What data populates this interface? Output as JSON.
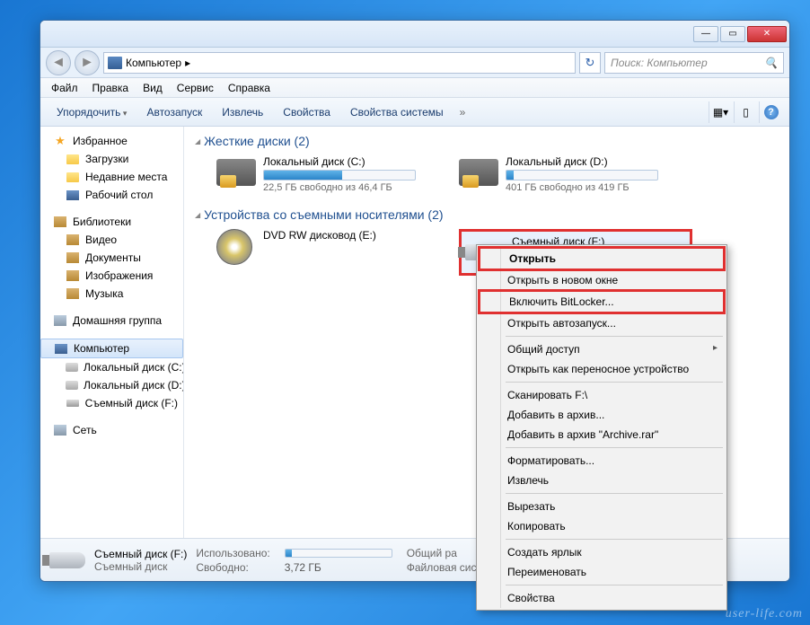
{
  "breadcrumb": {
    "root": "Компьютер",
    "sep": "▸"
  },
  "search": {
    "placeholder": "Поиск: Компьютер"
  },
  "menu": [
    "Файл",
    "Правка",
    "Вид",
    "Сервис",
    "Справка"
  ],
  "toolbar": {
    "items": [
      "Упорядочить",
      "Автозапуск",
      "Извлечь",
      "Свойства",
      "Свойства системы"
    ],
    "overflow": "»"
  },
  "sidebar": {
    "favorites": {
      "label": "Избранное",
      "items": [
        "Загрузки",
        "Недавние места",
        "Рабочий стол"
      ]
    },
    "libraries": {
      "label": "Библиотеки",
      "items": [
        "Видео",
        "Документы",
        "Изображения",
        "Музыка"
      ]
    },
    "homegroup": {
      "label": "Домашняя группа"
    },
    "computer": {
      "label": "Компьютер",
      "items": [
        "Локальный диск (C:)",
        "Локальный диск (D:)",
        "Съемный диск (F:)"
      ]
    },
    "network": {
      "label": "Сеть"
    }
  },
  "categories": {
    "hdd": {
      "label": "Жесткие диски (2)"
    },
    "removable": {
      "label": "Устройства со съемными носителями (2)"
    }
  },
  "drives": {
    "c": {
      "name": "Локальный диск (C:)",
      "free": "22,5 ГБ свободно из 46,4 ГБ",
      "pct": 52
    },
    "d": {
      "name": "Локальный диск (D:)",
      "free": "401 ГБ свободно из 419 ГБ",
      "pct": 5
    },
    "dvd": {
      "name": "DVD RW дисковод (E:)"
    },
    "usb": {
      "name": "Съемный диск (F:)"
    }
  },
  "status": {
    "title": "Съемный диск (F:)",
    "sub": "Съемный диск",
    "used_label": "Использовано:",
    "free_label": "Свободно:",
    "free_value": "3,72 ГБ",
    "total_label": "Общий ра",
    "fs_label": "Файловая сис"
  },
  "ctx": [
    {
      "label": "Открыть",
      "bold": true,
      "box": 1
    },
    {
      "label": "Открыть в новом окне"
    },
    {
      "label": "Включить BitLocker...",
      "box": 2
    },
    {
      "label": "Открыть автозапуск..."
    },
    {
      "sep": true
    },
    {
      "label": "Общий доступ",
      "arrow": true
    },
    {
      "label": "Открыть как переносное устройство"
    },
    {
      "sep": true
    },
    {
      "label": "Сканировать F:\\",
      "icon": "rar"
    },
    {
      "label": "Добавить в архив...",
      "icon": "rar"
    },
    {
      "label": "Добавить в архив \"Archive.rar\"",
      "icon": "rar"
    },
    {
      "sep": true
    },
    {
      "label": "Форматировать..."
    },
    {
      "label": "Извлечь"
    },
    {
      "sep": true
    },
    {
      "label": "Вырезать"
    },
    {
      "label": "Копировать"
    },
    {
      "sep": true
    },
    {
      "label": "Создать ярлык"
    },
    {
      "label": "Переименовать"
    },
    {
      "sep": true
    },
    {
      "label": "Свойства"
    }
  ],
  "watermark": "user-life.com"
}
